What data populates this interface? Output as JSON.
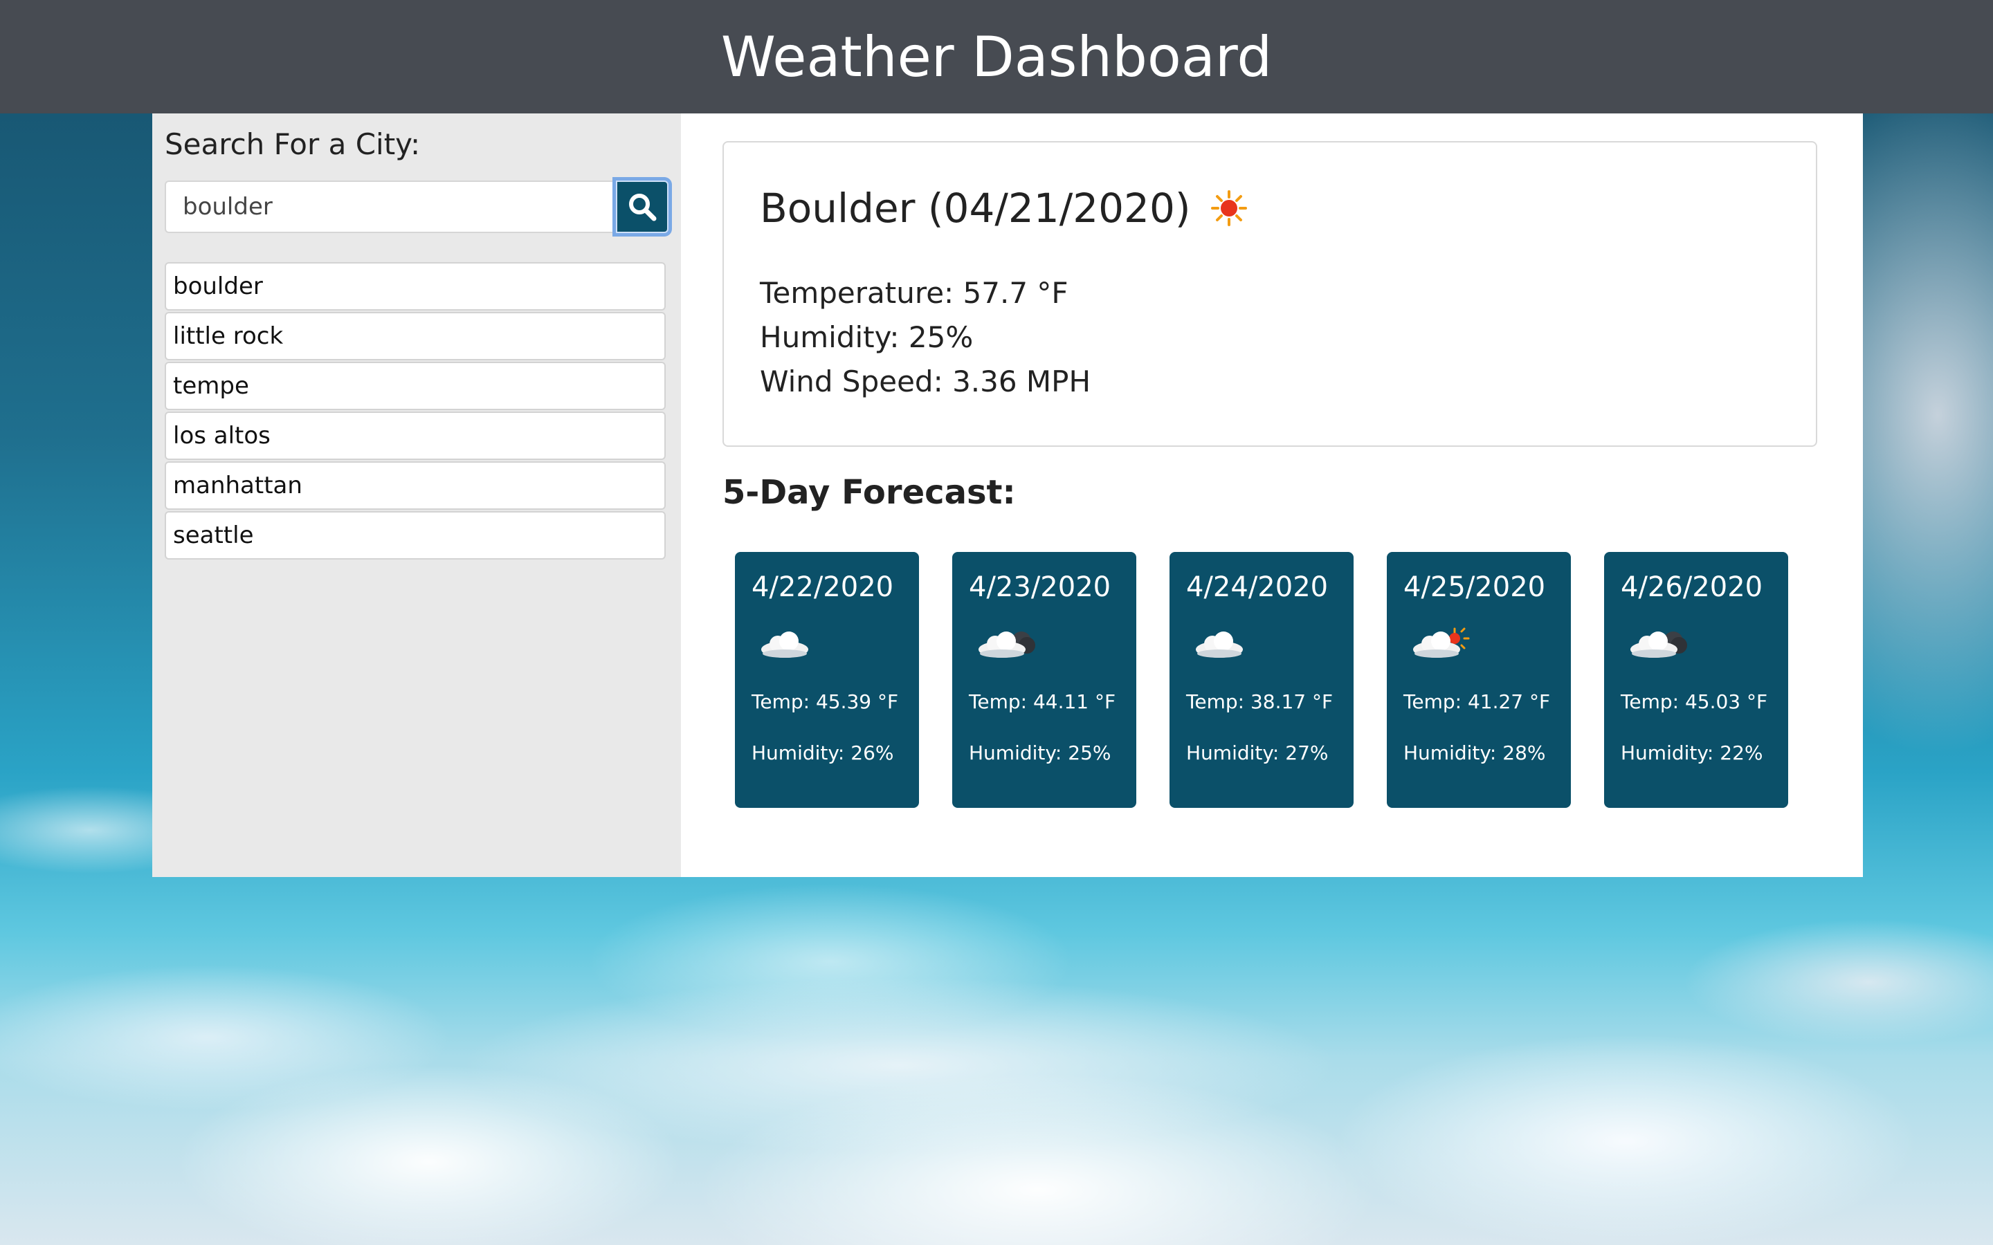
{
  "header": {
    "title": "Weather Dashboard"
  },
  "sidebar": {
    "search_label": "Search For a City:",
    "search_value": "boulder",
    "history": [
      "boulder",
      "little rock",
      "tempe",
      "los altos",
      "manhattan",
      "seattle"
    ]
  },
  "current": {
    "title": "Boulder (04/21/2020)",
    "icon": "sun-icon",
    "temperature": "Temperature: 57.7 °F",
    "humidity": "Humidity: 25%",
    "wind": "Wind Speed: 3.36 MPH"
  },
  "forecast": {
    "title": "5-Day Forecast:",
    "days": [
      {
        "date": "4/22/2020",
        "icon": "cloud-icon",
        "temp": "Temp: 45.39 °F",
        "humidity": "Humidity: 26%"
      },
      {
        "date": "4/23/2020",
        "icon": "cloud-night-icon",
        "temp": "Temp: 44.11 °F",
        "humidity": "Humidity: 25%"
      },
      {
        "date": "4/24/2020",
        "icon": "cloud-icon",
        "temp": "Temp: 38.17 °F",
        "humidity": "Humidity: 27%"
      },
      {
        "date": "4/25/2020",
        "icon": "cloud-sun-icon",
        "temp": "Temp: 41.27 °F",
        "humidity": "Humidity: 28%"
      },
      {
        "date": "4/26/2020",
        "icon": "cloud-night-icon",
        "temp": "Temp: 45.03 °F",
        "humidity": "Humidity: 22%"
      }
    ]
  },
  "colors": {
    "header_bg": "#474b52",
    "card_bg": "#0b5069",
    "sidebar_bg": "#e9e9e9"
  }
}
